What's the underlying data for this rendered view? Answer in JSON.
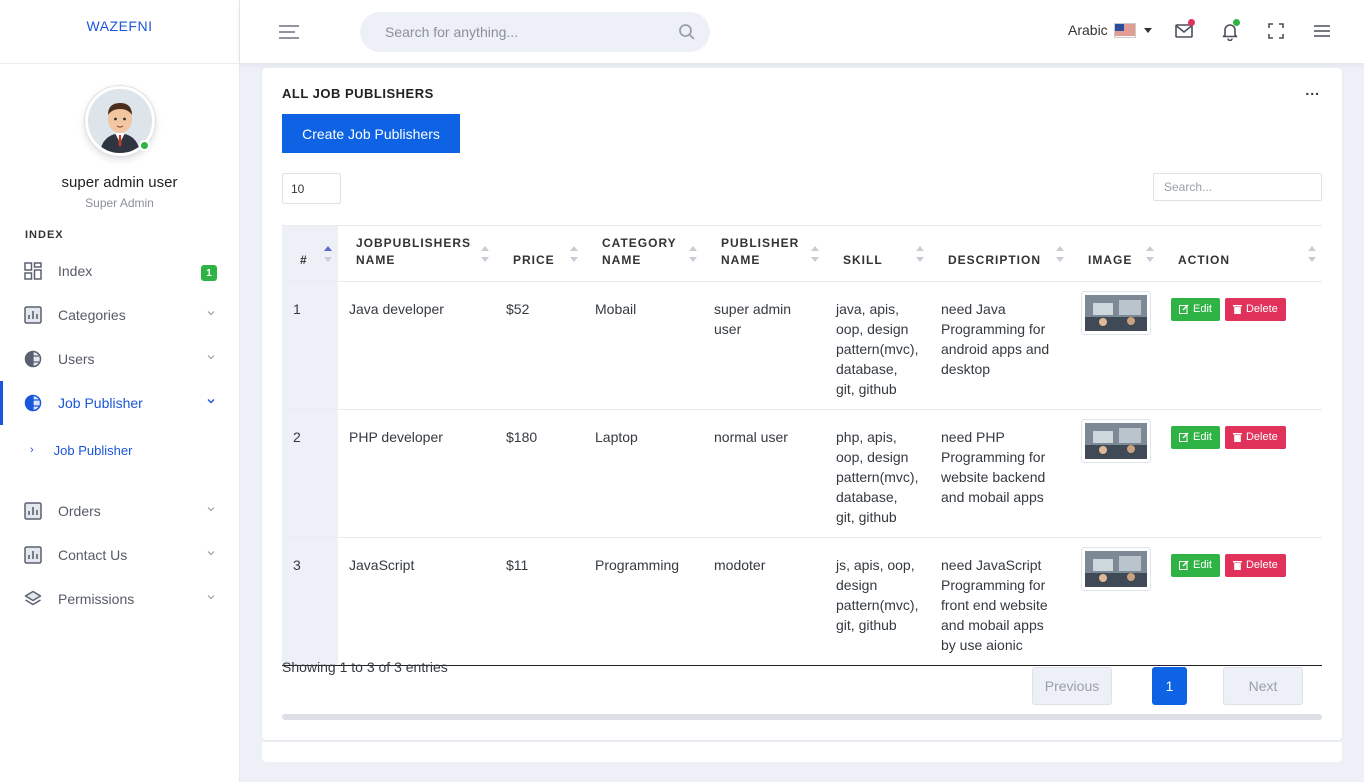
{
  "brand": "WAZEFNI",
  "profile": {
    "name": "super admin user",
    "role": "Super Admin"
  },
  "sidebar": {
    "section_title": "INDEX",
    "items": [
      {
        "label": "Index",
        "badge": "1"
      },
      {
        "label": "Categories"
      },
      {
        "label": "Users"
      },
      {
        "label": "Job Publisher",
        "active": true
      },
      {
        "label": "Orders"
      },
      {
        "label": "Contact Us"
      },
      {
        "label": "Permissions"
      }
    ],
    "sub_item": "Job Publisher"
  },
  "topbar": {
    "search_placeholder": "Search for anything...",
    "language": "Arabic"
  },
  "card": {
    "title": "ALL JOB PUBLISHERS",
    "menu": "...",
    "create_button": "Create Job Publishers",
    "page_length": "10",
    "search_placeholder": "Search..."
  },
  "table": {
    "headers": [
      "#",
      "JOBPUBLISHERS NAME",
      "PRICE",
      "CATEGORY NAME",
      "PUBLISHER NAME",
      "SKILL",
      "DESCRIPTION",
      "IMAGE",
      "ACTION"
    ],
    "rows": [
      {
        "id": "1",
        "name": "Java developer",
        "price": "$52",
        "category": "Mobail",
        "publisher": "super admin user",
        "skill": "java, apis, oop, design pattern(mvc), database, git, github",
        "description": "need Java Programming for android apps and desktop"
      },
      {
        "id": "2",
        "name": "PHP developer",
        "price": "$180",
        "category": "Laptop",
        "publisher": "normal user",
        "skill": "php, apis, oop, design pattern(mvc), database, git, github",
        "description": "need PHP Programming for website backend and mobail apps"
      },
      {
        "id": "3",
        "name": "JavaScript",
        "price": "$11",
        "category": "Programming",
        "publisher": "modoter",
        "skill": "js, apis, oop, design pattern(mvc), git, github",
        "description": "need JavaScript Programming for front end website and mobail apps by use aionic"
      }
    ],
    "edit_label": "Edit",
    "delete_label": "Delete"
  },
  "footer": {
    "info": "Showing 1 to 3 of 3 entries",
    "previous": "Previous",
    "page": "1",
    "next": "Next"
  },
  "colors": {
    "primary": "#0d63e3",
    "success": "#2fb344",
    "danger": "#e0325a",
    "background": "#eef0f8"
  },
  "icons": [
    "menu-icon",
    "search-icon",
    "us-flag-icon",
    "mail-icon",
    "bell-icon",
    "fullscreen-icon",
    "hamburger-icon",
    "dashboard-icon",
    "chart-icon",
    "half-circle-icon",
    "layers-icon",
    "chevron-down-icon",
    "edit-icon",
    "trash-icon"
  ]
}
